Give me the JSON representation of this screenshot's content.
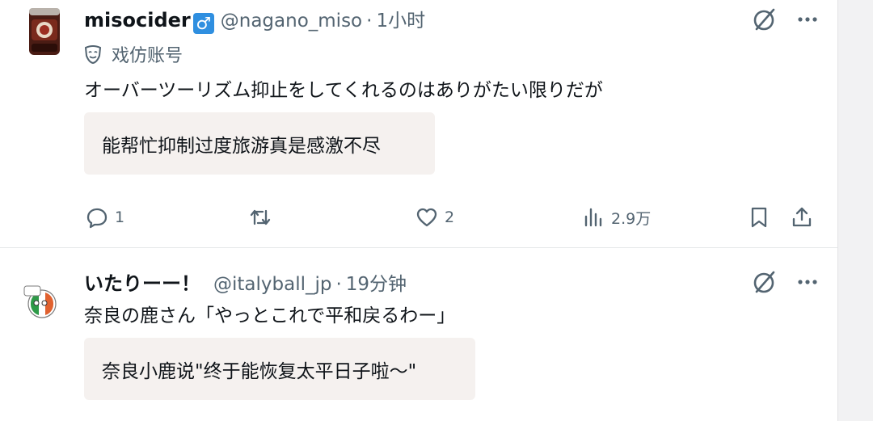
{
  "tweets": [
    {
      "name": "misocider",
      "badge": "♂",
      "handle": "@nagano_miso",
      "separator": "·",
      "time": "1小时",
      "label": "戏仿账号",
      "text": "オーバーツーリズム抑止をしてくれるのはありがたい限りだが",
      "translation": "能帮忙抑制过度旅游真是感激不尽",
      "actions": {
        "replies": "1",
        "retweets": "",
        "likes": "2",
        "views": "2.9万"
      }
    },
    {
      "name": "いたりーー！",
      "handle": "@italyball_jp",
      "separator": "·",
      "time": "19分钟",
      "text": "奈良の鹿さん「やっとこれで平和戻るわー」",
      "translation": "奈良小鹿说\"终于能恢复太平日子啦～\""
    }
  ],
  "icons": {
    "grok": "grok-slash-circle-icon",
    "more": "more-dots-icon",
    "reply": "reply-bubble-icon",
    "retweet": "retweet-arrows-icon",
    "like": "heart-icon",
    "views": "views-bar-icon",
    "bookmark": "bookmark-icon",
    "share": "share-upload-icon",
    "label": "parody-mask-icon"
  },
  "colors": {
    "text": "#0f1419",
    "secondary": "#536471",
    "badge": "#2f8fe0",
    "translation_bg": "#f5f1ef"
  }
}
